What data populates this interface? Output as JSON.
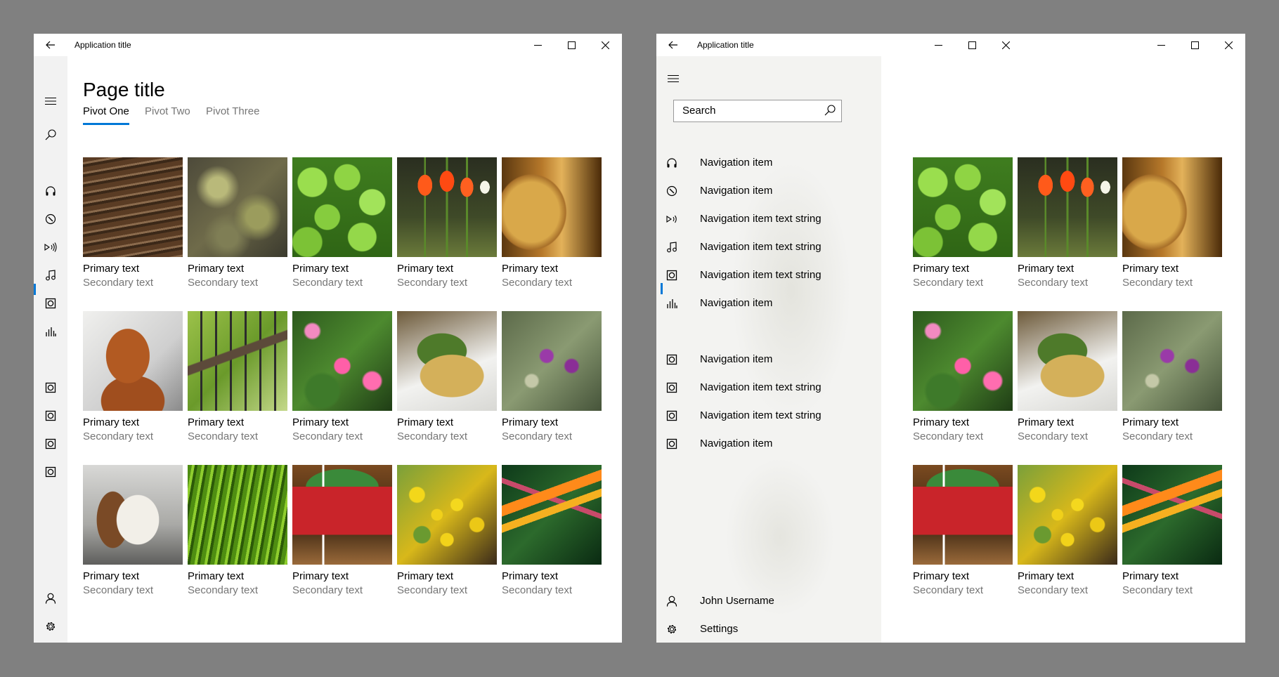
{
  "app_title": "Application title",
  "left": {
    "page_title": "Page title",
    "pivots": [
      "Pivot One",
      "Pivot Two",
      "Pivot Three"
    ],
    "selected_pivot": "Pivot One",
    "tiles": [
      {
        "primary": "Primary text",
        "secondary": "Secondary text",
        "image": "lumber-stacks"
      },
      {
        "primary": "Primary text",
        "secondary": "Secondary text",
        "image": "mossy-bark"
      },
      {
        "primary": "Primary text",
        "secondary": "Secondary text",
        "image": "clover-leaves"
      },
      {
        "primary": "Primary text",
        "secondary": "Secondary text",
        "image": "red-tulips"
      },
      {
        "primary": "Primary text",
        "secondary": "Secondary text",
        "image": "wine-barrels"
      },
      {
        "primary": "Primary text",
        "secondary": "Secondary text",
        "image": "dachshund"
      },
      {
        "primary": "Primary text",
        "secondary": "Secondary text",
        "image": "iron-railing"
      },
      {
        "primary": "Primary text",
        "secondary": "Secondary text",
        "image": "pink-azaleas"
      },
      {
        "primary": "Primary text",
        "secondary": "Secondary text",
        "image": "plated-food"
      },
      {
        "primary": "Primary text",
        "secondary": "Secondary text",
        "image": "thistle-flowers"
      },
      {
        "primary": "Primary text",
        "secondary": "Secondary text",
        "image": "basset-hound"
      },
      {
        "primary": "Primary text",
        "secondary": "Secondary text",
        "image": "green-grass"
      },
      {
        "primary": "Primary text",
        "secondary": "Secondary text",
        "image": "red-barn-birdhouse"
      },
      {
        "primary": "Primary text",
        "secondary": "Secondary text",
        "image": "market-produce"
      },
      {
        "primary": "Primary text",
        "secondary": "Secondary text",
        "image": "bird-of-paradise"
      }
    ]
  },
  "right": {
    "search_placeholder": "Search",
    "nav_items": [
      {
        "label": "Navigation item",
        "icon": "headphones-icon"
      },
      {
        "label": "Navigation item",
        "icon": "compass-icon"
      },
      {
        "label": "Navigation item text string",
        "icon": "broadcast-icon"
      },
      {
        "label": "Navigation item text string",
        "icon": "music-note-icon",
        "selected": true
      },
      {
        "label": "Navigation item text string",
        "icon": "speaker-icon"
      },
      {
        "label": "Navigation item",
        "icon": "equalizer-icon"
      },
      {
        "label": "Navigation item",
        "icon": "speaker-icon"
      },
      {
        "label": "Navigation item text string",
        "icon": "speaker-icon"
      },
      {
        "label": "Navigation item text string",
        "icon": "speaker-icon"
      },
      {
        "label": "Navigation item",
        "icon": "speaker-icon"
      }
    ],
    "user_name": "John Username",
    "settings_label": "Settings",
    "tiles": [
      {
        "primary": "Primary text",
        "secondary": "Secondary text",
        "image": "clover-leaves"
      },
      {
        "primary": "Primary text",
        "secondary": "Secondary text",
        "image": "red-tulips"
      },
      {
        "primary": "Primary text",
        "secondary": "Secondary text",
        "image": "wine-barrels"
      },
      {
        "primary": "Primary text",
        "secondary": "Secondary text",
        "image": "pink-azaleas"
      },
      {
        "primary": "Primary text",
        "secondary": "Secondary text",
        "image": "plated-food"
      },
      {
        "primary": "Primary text",
        "secondary": "Secondary text",
        "image": "thistle-flowers"
      },
      {
        "primary": "Primary text",
        "secondary": "Secondary text",
        "image": "red-barn-birdhouse"
      },
      {
        "primary": "Primary text",
        "secondary": "Secondary text",
        "image": "market-produce"
      },
      {
        "primary": "Primary text",
        "secondary": "Secondary text",
        "image": "bird-of-paradise"
      }
    ]
  },
  "colors": {
    "accent": "#0078d7",
    "secondary_text": "#767676",
    "rail_bg": "#f2f2f2",
    "backdrop": "#808080"
  }
}
